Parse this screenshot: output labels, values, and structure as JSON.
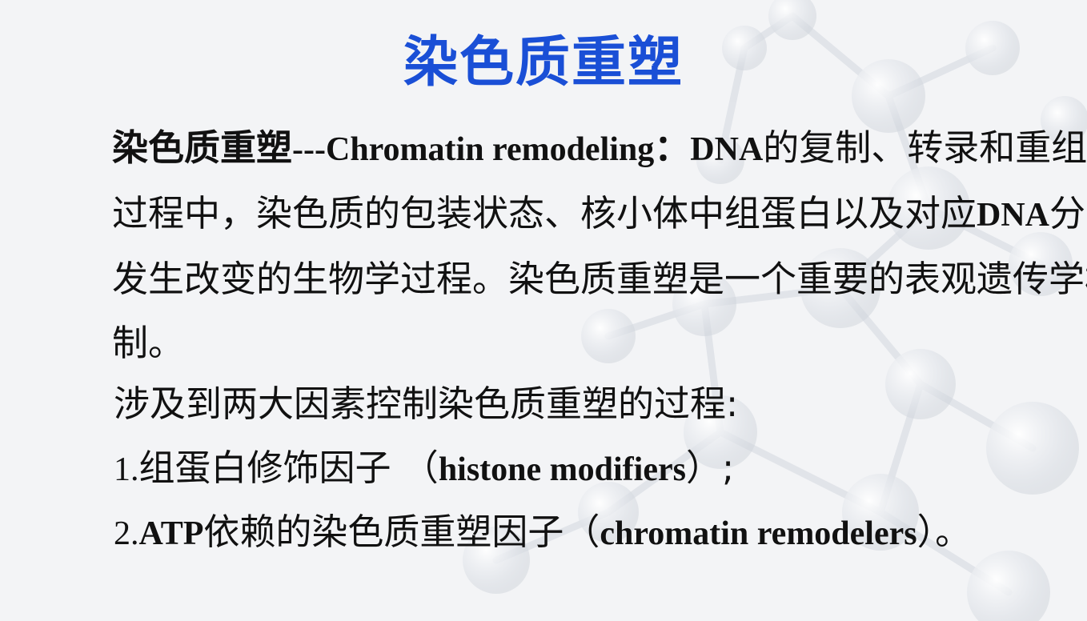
{
  "slide": {
    "title": "染色质重塑",
    "definition": {
      "term": "染色质重塑",
      "dashes": "---",
      "term_en": "Chromatin  remodeling",
      "colon": "：",
      "dna_1": "DNA",
      "text_1": "的复制、转录和重组等过程中，染色质的包装状态、核小体中组蛋白以及对应",
      "dna_2": "DNA",
      "text_2": "分子发生改变的生物学过程。染色质重塑是一个重要的表观遗传学机制。"
    },
    "factors_intro": "涉及到两大因素控制染色质重塑的过程:",
    "factor_1": {
      "prefix": "1.",
      "name": "组蛋白修饰因子 （",
      "name_en": "histone modifiers",
      "suffix": "）;"
    },
    "factor_2": {
      "prefix": "2.",
      "atp": "ATP",
      "name": "依赖的染色质重塑因子（",
      "name_en": "chromatin  remodelers",
      "suffix": "）。"
    }
  }
}
